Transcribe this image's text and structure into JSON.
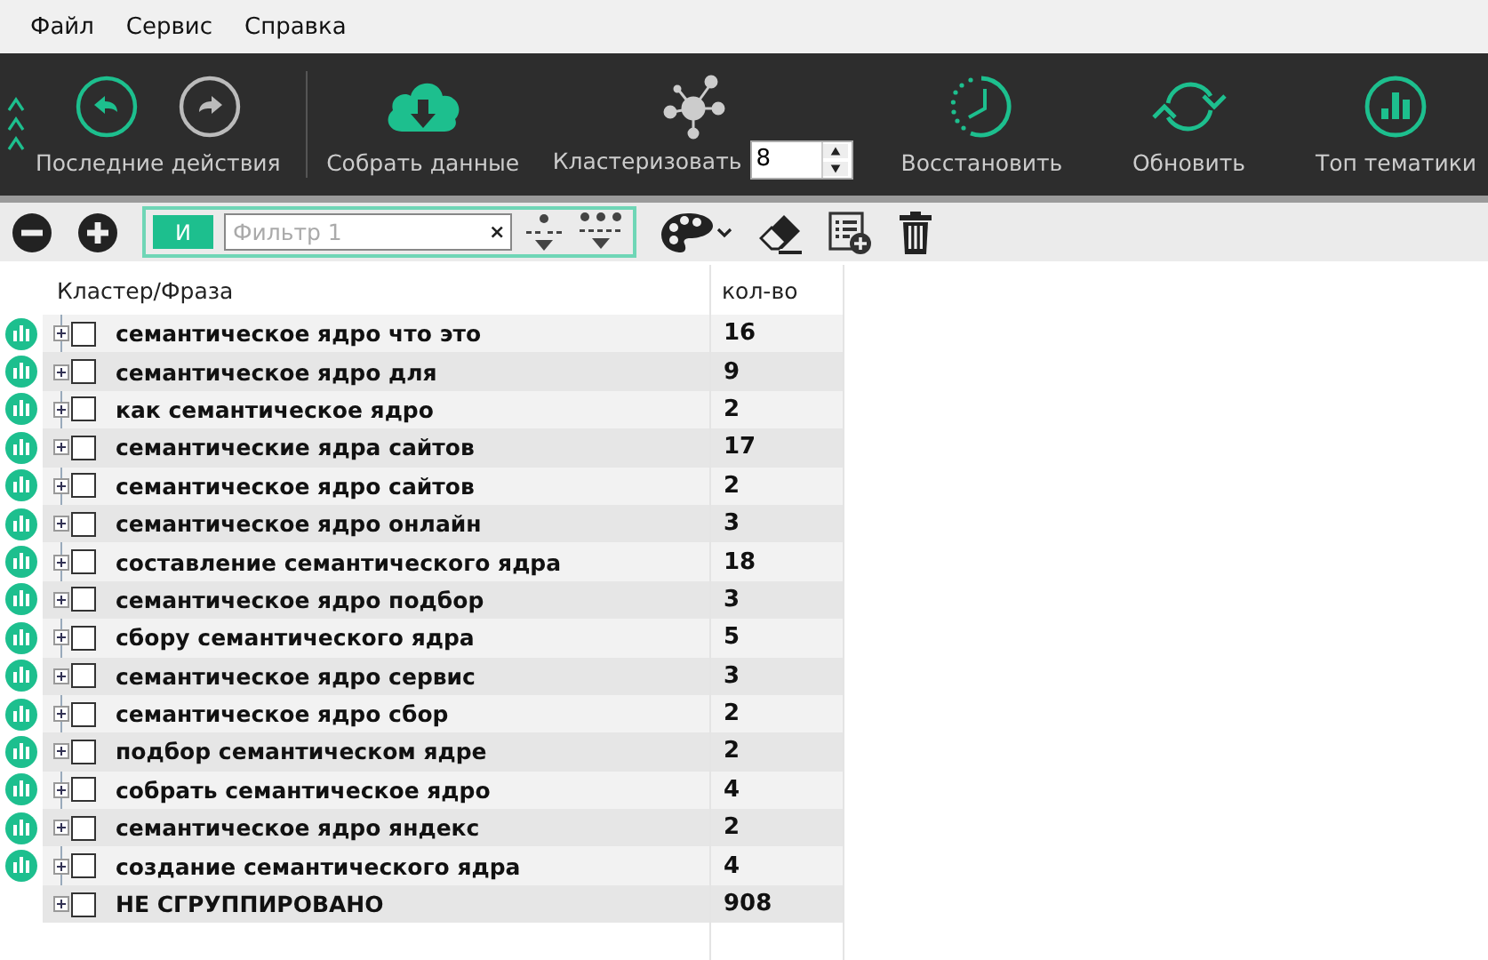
{
  "menu": [
    "Файл",
    "Сервис",
    "Справка"
  ],
  "toolbar": {
    "recent_actions": "Последние действия",
    "collect": "Собрать данные",
    "cluster": {
      "label": "Кластеризовать",
      "value": "8"
    },
    "restore": "Восстановить",
    "refresh": "Обновить",
    "top": "Топ тематики"
  },
  "filter": {
    "mode": "И",
    "placeholder": "Фильтр 1",
    "clear": "×"
  },
  "table": {
    "columns": [
      "Кластер/Фраза",
      "кол-во"
    ],
    "rows": [
      {
        "kind": "cluster",
        "phrase": "семантическое ядро что это",
        "count": "16",
        "expanded": false,
        "checked": false
      },
      {
        "kind": "cluster",
        "phrase": "семантическое ядро для",
        "count": "9",
        "expanded": false,
        "checked": false
      },
      {
        "kind": "cluster",
        "phrase": "как семантическое ядро",
        "count": "2",
        "expanded": false,
        "checked": false
      },
      {
        "kind": "cluster",
        "phrase": "семантические ядра сайтов",
        "count": "17",
        "expanded": false,
        "checked": false
      },
      {
        "kind": "cluster",
        "phrase": "семантическое ядро сайтов",
        "count": "2",
        "expanded": false,
        "checked": false
      },
      {
        "kind": "cluster",
        "phrase": "семантическое ядро онлайн",
        "count": "3",
        "expanded": false,
        "checked": false
      },
      {
        "kind": "cluster",
        "phrase": "составление семантического ядра",
        "count": "18",
        "expanded": false,
        "checked": false
      },
      {
        "kind": "cluster",
        "phrase": "семантическое ядро подбор",
        "count": "3",
        "expanded": false,
        "checked": false
      },
      {
        "kind": "cluster",
        "phrase": "сбору семантического ядра",
        "count": "5",
        "expanded": false,
        "checked": false
      },
      {
        "kind": "cluster",
        "phrase": "семантическое ядро сервис",
        "count": "3",
        "expanded": false,
        "checked": false
      },
      {
        "kind": "cluster",
        "phrase": "семантическое ядро сбор",
        "count": "2",
        "expanded": false,
        "checked": false
      },
      {
        "kind": "cluster",
        "phrase": "подбор семантическом ядре",
        "count": "2",
        "expanded": false,
        "checked": false
      },
      {
        "kind": "cluster",
        "phrase": "собрать семантическое ядро",
        "count": "4",
        "expanded": false,
        "checked": false
      },
      {
        "kind": "cluster",
        "phrase": "семантическое ядро яндекс",
        "count": "2",
        "expanded": false,
        "checked": false
      },
      {
        "kind": "cluster",
        "phrase": "создание семантического ядра",
        "count": "4",
        "expanded": false,
        "checked": false
      },
      {
        "kind": "ungrouped",
        "phrase": "НЕ СГРУППИРОВАНО",
        "count": "908",
        "expanded": false,
        "checked": false
      }
    ]
  }
}
